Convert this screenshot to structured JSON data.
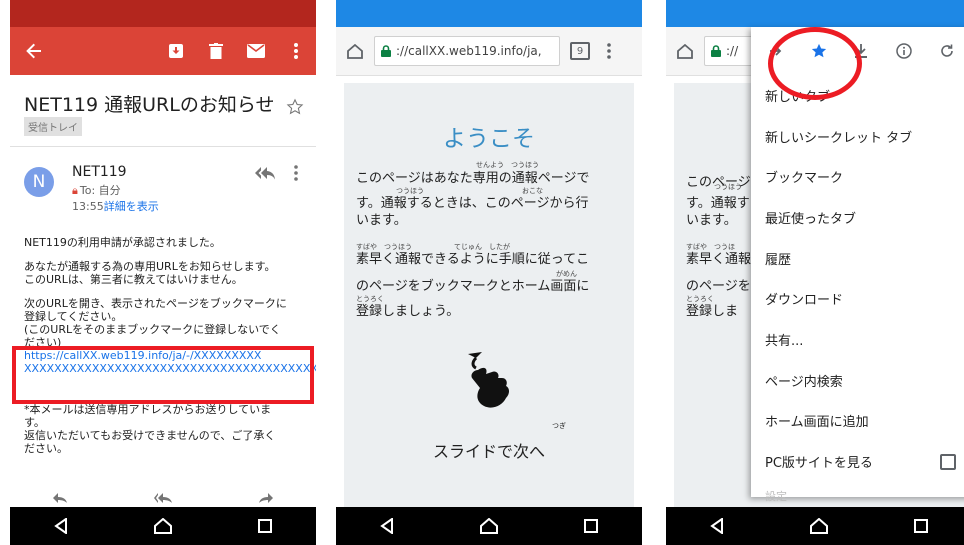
{
  "gmail": {
    "subject": "NET119 通報URLのお知らせ",
    "label": "受信トレイ",
    "avatar_letter": "N",
    "sender": "NET119",
    "to_prefix": "To:",
    "to": "自分",
    "time": "13:55",
    "details_link": "詳細を表示",
    "body_line1": "NET119の利用申請が承認されました。",
    "body_p2_l1": "あなたが通報する為の専用URLをお知らせします。",
    "body_p2_l2": "このURLは、第三者に教えてはいけません。",
    "body_p3_l1": "次のURLを開き、表示されたページをブックマークに",
    "body_p3_l2": "登録してください。",
    "body_p3_l3": "(このURLをそのままブックマークに登録しないでく",
    "body_p3_l4": "ださい)",
    "url_line1": "https://callXX.web119.info/ja/-/XXXXXXXXX",
    "url_line2": "XXXXXXXXXXXXXXXXXXXXXXXXXXXXXXXXXXXXXXX",
    "footer_l1": "*本メールは送信専用アドレスからお送りしていま",
    "footer_l2": "す。",
    "footer_l3": "返信いただいてもお受けできませんので、ご了承く",
    "footer_l4": "ださい。"
  },
  "browser": {
    "url": "://callXX.web119.info/ja,",
    "url_short": "://",
    "tab_count": "9"
  },
  "welcome_page": {
    "title": "ようこそ",
    "p1_ruby": "せんよう　つうほう",
    "p1_l1": "このページはあなた専用の通報ページで",
    "p1_ruby2": "つうほう　　　　　　　　　　　　　　おこな",
    "p1_l2": "す。通報するときは、このページから行",
    "p1_l3": "います。",
    "p2_ruby": "すばや　つうほう　　　　　　てじゅん　したが",
    "p2_l1": "素早く通報できるように手順に従ってこ",
    "p2_ruby2": "がめん",
    "p2_l2": "のページをブックマークとホーム画面に",
    "p2_ruby3": "とうろく",
    "p2_l3": "登録しましょう。",
    "slide_ruby": "つぎ",
    "slide": "スライドで次へ"
  },
  "behind_page": {
    "l1_ruby": "つうほう",
    "l1": "このページ",
    "l2": "す。通報す",
    "l3": "います。",
    "l4_ruby": "すばや　つうほ",
    "l4": "素早く通報",
    "l5": "のページを",
    "l6_ruby": "とうろく",
    "l6": "登録しま"
  },
  "menu": {
    "items": [
      "新しいタブ",
      "新しいシークレット タブ",
      "ブックマーク",
      "最近使ったタブ",
      "履歴",
      "ダウンロード",
      "共有...",
      "ページ内検索",
      "ホーム画面に追加",
      "PC版サイトを見る",
      "設定"
    ]
  },
  "colors": {
    "gmail_red": "#db4437",
    "chrome_blue": "#1e88e5",
    "highlight_red": "#ec1c24",
    "welcome_blue": "#3a8ec5"
  }
}
